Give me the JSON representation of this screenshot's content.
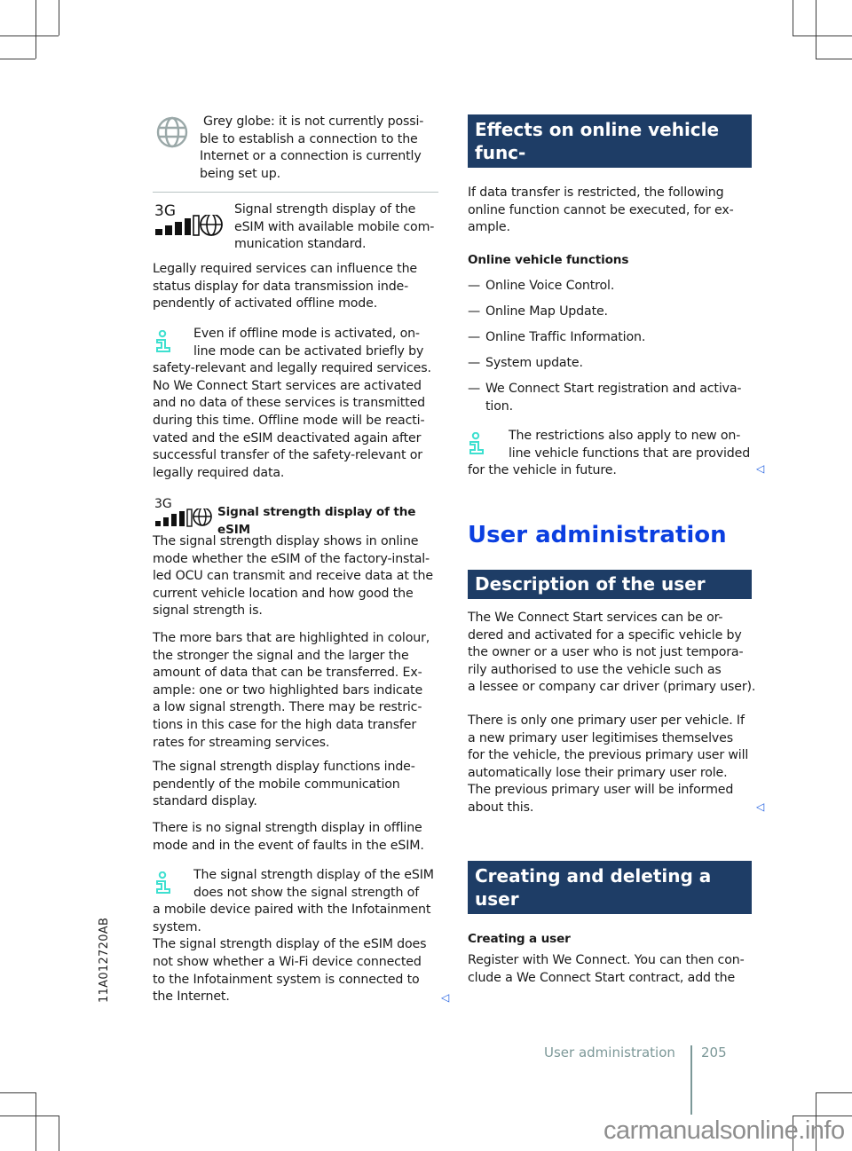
{
  "left_column": {
    "globe_legend": "Grey globe: it is not currently possi-\nble to establish a connection to the\nInternet or a connection is currently\nbeing set up.",
    "signal_legend_network": "3G",
    "signal_legend": "Signal strength display of the\neSIM with available mobile com-\nmunication standard.",
    "para_legal": "Legally required services can influence the\nstatus display for data transmission inde-\npendently of activated offline mode.",
    "note_offline": "Even if offline mode is activated, on-\nline mode can be activated briefly by\nsafety-relevant and legally required services.\nNo We Connect Start services are activated\nand no data of these services is transmitted\nduring this time. Offline mode will be reacti-\nvated and the eSIM deactivated again after\nsuccessful transfer of the safety-relevant or\nlegally required data.",
    "signal_heading_network": "3G",
    "signal_heading": "Signal strength display of the eSIM",
    "para_signal_1": "The signal strength display shows in online\nmode whether the eSIM of the factory-instal-\nled OCU can transmit and receive data at the\ncurrent vehicle location and how good the\nsignal strength is.",
    "para_signal_2": "The more bars that are highlighted in colour,\nthe stronger the signal and the larger the\namount of data that can be transferred. Ex-\nample: one or two highlighted bars indicate\na low signal strength. There may be restric-\ntions in this case for the high data transfer\nrates for streaming services.",
    "para_signal_3": "The signal strength display functions inde-\npendently of the mobile communication\nstandard display.",
    "para_signal_4": "There is no signal strength display in offline\nmode and in the event of faults in the eSIM.",
    "note_signal": "The signal strength display of the eSIM\ndoes not show the signal strength of\na mobile device paired with the Infotainment\nsystem.\nThe signal strength display of the eSIM does\nnot show whether a Wi-Fi device connected\nto the Infotainment system is connected to\nthe Internet.",
    "end_mark": "◁"
  },
  "right_column": {
    "heading_effects": "Effects on online vehicle func-\ntions",
    "para_effects": "If data transfer is restricted, the following\nonline function cannot be executed, for ex-\nample.",
    "subheading_functions": "Online vehicle functions",
    "functions": [
      {
        "dash": "—",
        "text": "Online Voice Control."
      },
      {
        "dash": "—",
        "text": "Online Map Update."
      },
      {
        "dash": "—",
        "text": "Online Traffic Information."
      },
      {
        "dash": "—",
        "text": "System update."
      },
      {
        "dash": "—",
        "text": "We Connect Start registration and activa-\ntion."
      }
    ],
    "note_restrictions": "The restrictions also apply to new on-\nline vehicle functions that are provided\nfor the vehicle in future.",
    "chapter_title": "User administration",
    "heading_user_role": "Description of the user role",
    "para_user_role_1": "The We Connect Start services can be or-\ndered and activated for a specific vehicle by\nthe owner or a user who is not just tempora-\nrily authorised to use the vehicle such as\na lessee or company car driver (primary user).",
    "para_user_role_2": "There is only one primary user per vehicle. If\na new primary user legitimises themselves\nfor the vehicle, the previous primary user will\nautomatically lose their primary user role.\nThe previous primary user will be informed\nabout this.",
    "heading_create_delete": "Creating and deleting a user\nrole",
    "subheading_create": "Creating a user",
    "para_create": "Register with We Connect. You can then con-\nclude a We Connect Start contract, add the",
    "end_mark": "◁"
  },
  "footer": {
    "section": "User administration",
    "page_number": "205"
  },
  "side_code": "11A012720AB",
  "watermark": "carmanualsonline.info",
  "colors": {
    "heading_bg": "#1e3d66",
    "chapter_title": "#0b3fe0",
    "info_icon": "#3ee0d0",
    "footer": "#7c9898",
    "end_mark": "#1b5be0"
  }
}
